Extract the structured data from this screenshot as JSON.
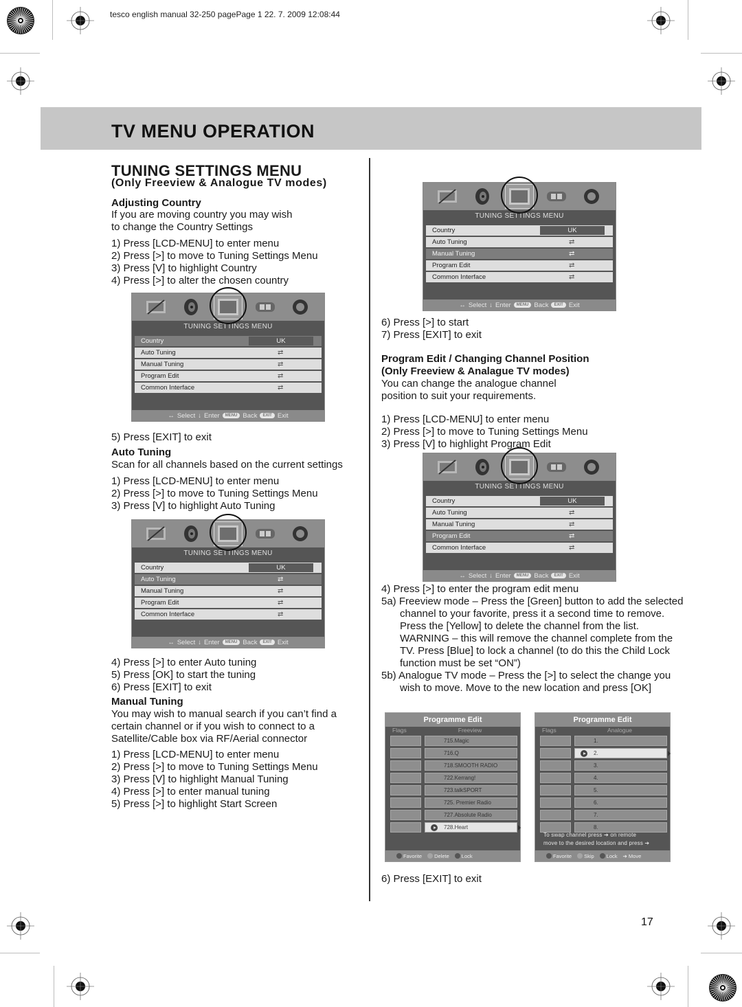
{
  "slug": "tesco english manual 32-250 pagePage 1   22. 7. 2009   12:08:44",
  "header": {
    "title": "TV MENU OPERATION"
  },
  "section": {
    "title": "TUNING SETTINGS MENU",
    "subtitle": "(Only Freeview & Analogue TV modes)"
  },
  "adjusting_country": {
    "heading": "Adjusting Country",
    "intro": [
      "If you are moving country you may wish",
      "to change the Country Settings"
    ],
    "steps": [
      "1) Press [LCD-MENU] to enter menu",
      "2) Press [>] to move to Tuning Settings Menu",
      "3) Press [V] to highlight Country",
      "4) Press [>] to alter the chosen country"
    ],
    "after": "5) Press [EXIT] to exit"
  },
  "auto_tuning": {
    "heading": "Auto Tuning",
    "intro": "Scan for all channels based on the current settings",
    "steps": [
      "1) Press [LCD-MENU] to enter menu",
      "2) Press [>] to move to Tuning Settings Menu",
      "3) Press [V] to highlight Auto Tuning"
    ],
    "after": [
      "4) Press [>] to enter Auto tuning",
      "5) Press [OK] to start the tuning",
      "6) Press [EXIT] to exit"
    ]
  },
  "manual_tuning": {
    "heading": "Manual Tuning",
    "intro": [
      "You may wish to manual search if you can’t find a",
      "certain channel or if you wish to connect to a",
      "Satellite/Cable box via RF/Aerial connector"
    ],
    "steps": [
      "1) Press [LCD-MENU] to enter menu",
      "2) Press [>] to move to Tuning Settings Menu",
      "3) Press [V] to highlight Manual Tuning",
      "4) Press [>] to enter manual tuning",
      "5) Press [>] to highlight Start Screen"
    ],
    "after": [
      "6) Press [>] to start",
      "7) Press [EXIT] to exit"
    ]
  },
  "program_edit": {
    "heading": [
      "Program Edit / Changing Channel Position",
      "(Only Freeview & Analague TV modes)"
    ],
    "intro": [
      "You can change the analogue channel",
      "position to suit your requirements."
    ],
    "steps": [
      "1) Press [LCD-MENU] to enter menu",
      "2) Press [>] to move to Tuning Settings Menu",
      "3) Press [V] to highlight Program Edit"
    ],
    "after": [
      "4) Press [>] to enter the program edit menu",
      "5a) Freeview mode – Press the [Green] button to add the selected channel to your favorite, press it a second time to remove. Press the [Yellow] to delete the channel from the list. WARNING – this will remove the channel complete from the TV. Press [Blue] to lock a channel (to do this the Child Lock function must be set “ON”)",
      "5b) Analogue TV mode – Press the [>] to select the change you wish to move. Move to the new location and press [OK]"
    ],
    "final": "6) Press [EXIT] to exit"
  },
  "osd": {
    "icons": [
      "picture-icon",
      "sound-icon",
      "tv-tuning-icon",
      "clock-icon",
      "setup-icon"
    ],
    "title": "TUNING SETTINGS MENU",
    "items": [
      "Country",
      "Auto Tuning",
      "Manual Tuning",
      "Program Edit",
      "Common Interface"
    ],
    "country_value": "UK",
    "arrow": "⇄",
    "footer": {
      "select": "Select",
      "enter": "Enter",
      "menu_pill": "MENU",
      "back": "Back",
      "exit_pill": "EXIT",
      "exit": "Exit"
    },
    "screens": [
      {
        "highlighted": "Country"
      },
      {
        "highlighted": "Auto Tuning"
      },
      {
        "highlighted": "Manual Tuning"
      },
      {
        "highlighted": "Program Edit"
      }
    ]
  },
  "programme_edit_freeview": {
    "title": "Programme Edit",
    "col_flags": "Flags",
    "col_list": "Freeview",
    "channels": [
      "715.Magic",
      "716.Q",
      "718.SMOOTH RADIO",
      "722.Kerrang!",
      "723.talkSPORT",
      "725. Premier Radio",
      "727.Absolute Radio",
      "728.Heart"
    ],
    "selected_index": 7,
    "footer": [
      "Favorite",
      "Delete",
      "Lock"
    ]
  },
  "programme_edit_analogue": {
    "title": "Programme Edit",
    "col_flags": "Flags",
    "col_list": "Analogue",
    "channels": [
      "1.",
      "2.",
      "3.",
      "4.",
      "5.",
      "6.",
      "7.",
      "8."
    ],
    "selected_index": 1,
    "note": [
      "To swap channel press ➔  on  remote",
      "move to the desired location and press ➔"
    ],
    "footer": [
      "Favorite",
      "Skip",
      "Lock",
      "➔ Move"
    ]
  },
  "page_number": "17"
}
